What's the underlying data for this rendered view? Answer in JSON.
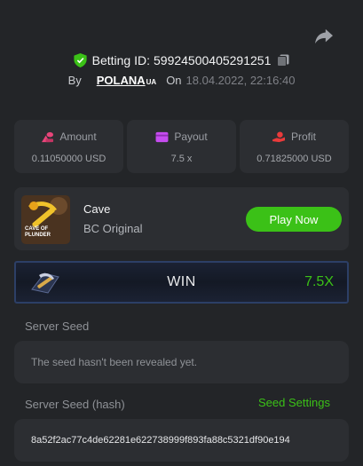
{
  "header": {
    "betting_id_label": "Betting ID:",
    "betting_id": "59924500405291251",
    "by_label": "By",
    "username": "POLANA",
    "username_suffix": "UA",
    "on_label": "On",
    "datetime": "18.04.2022, 22:16:40"
  },
  "stats": [
    {
      "label": "Amount",
      "value": "0.11050000 USD",
      "icon": "coins-icon",
      "color": "#e8457a"
    },
    {
      "label": "Payout",
      "value": "7.5 x",
      "icon": "wallet-icon",
      "color": "#c64cf0"
    },
    {
      "label": "Profit",
      "value": "0.71825000 USD",
      "icon": "hand-coin-icon",
      "color": "#ea3b3b"
    }
  ],
  "game": {
    "thumb_caption": "CAVE OF PLUNDER",
    "name": "Cave",
    "provider": "BC Original",
    "play_label": "Play Now"
  },
  "result": {
    "text": "WIN",
    "multiplier": "7.5X"
  },
  "server_seed": {
    "label": "Server Seed",
    "value": "The seed hasn't been revealed yet."
  },
  "server_seed_hash": {
    "label": "Server Seed (hash)",
    "settings_link": "Seed Settings",
    "value": "8a52f2ac77c4de62281e622738999f893fa88c5321df90e194"
  },
  "colors": {
    "accent_green": "#3bc117",
    "background": "#232528",
    "card": "#2c2e32"
  }
}
